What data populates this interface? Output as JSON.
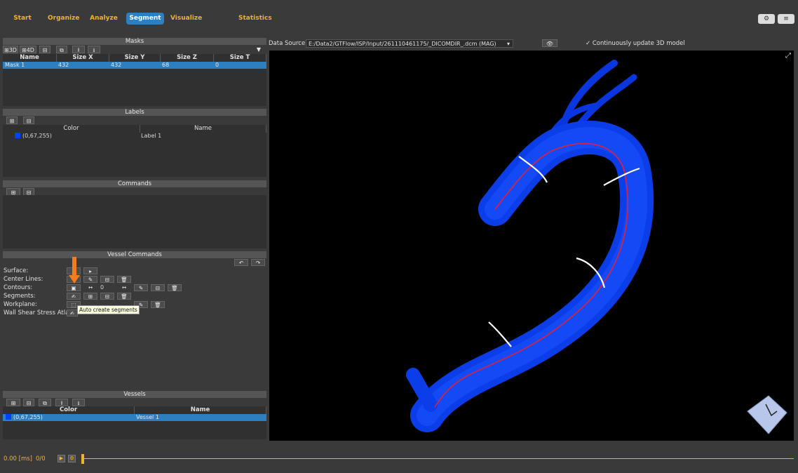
{
  "nav": {
    "tabs": [
      {
        "label": "Start"
      },
      {
        "label": "Organize"
      },
      {
        "label": "Analyze"
      },
      {
        "label": "Segment"
      },
      {
        "label": "Visualize"
      },
      {
        "label": "Statistics"
      }
    ],
    "active_tab": "Segment",
    "right_buttons": [
      {
        "icon": "settings-icon",
        "glyph": "⚙"
      },
      {
        "icon": "menu-icon",
        "glyph": "≡"
      }
    ]
  },
  "masks": {
    "title": "Masks",
    "toolbar": {
      "btn_3d": "⊞3D",
      "btn_4d": "⊞4D",
      "minus": "⊟",
      "copy": "⧉",
      "upload": "⭱",
      "download": "⭳",
      "filter": "▼"
    },
    "columns": [
      "Name",
      "Size X",
      "Size Y",
      "Size Z",
      "Size T"
    ],
    "rows": [
      [
        "Mask 1",
        "432",
        "432",
        "68",
        "0"
      ]
    ]
  },
  "labels": {
    "title": "Labels",
    "toolbar": {
      "add": "⊞",
      "minus": "⊟"
    },
    "columns": [
      "Color",
      "Name"
    ],
    "rows": [
      {
        "color": "(0,67,255)",
        "name": "Label 1"
      }
    ]
  },
  "commands": {
    "title": "Commands",
    "toolbar": {
      "add": "⊞",
      "minus": "⊟"
    }
  },
  "vessel_commands": {
    "title": "Vessel Commands",
    "undo": "↶",
    "redo": "↷",
    "rows": [
      {
        "label": "Surface:"
      },
      {
        "label": "Center Lines:"
      },
      {
        "label": "Contours:",
        "value": "0"
      },
      {
        "label": "Segments:"
      },
      {
        "label": "Workplane:"
      },
      {
        "label": "Wall Shear Stress Atlas:"
      }
    ],
    "tooltip": "Auto create segments"
  },
  "vessels": {
    "title": "Vessels",
    "toolbar": {
      "add": "⊞",
      "minus": "⊟",
      "copy": "⧉",
      "upload": "⭱",
      "download": "⭳"
    },
    "columns": [
      "Color",
      "Name"
    ],
    "rows": [
      {
        "color": "(0,67,255)",
        "name": "Vessel 1"
      }
    ]
  },
  "viewer": {
    "data_source_label": "Data Source:",
    "data_source_value": "E:/Data2/GTFlow/ISP/Input/261110461175/_DICOMDIR_.dcm (MAG)",
    "eye": "👁",
    "continuous_update": "✓ Continuously update 3D model",
    "expand": "⤢"
  },
  "timeline": {
    "time": "0.00 [ms]",
    "frame": "0/0",
    "play": "▶",
    "settings": "⚙"
  },
  "colors": {
    "accent": "#f0b428",
    "selection": "#2e7fc0",
    "vessel": "#0043ff",
    "centerline": "#e0203a"
  }
}
